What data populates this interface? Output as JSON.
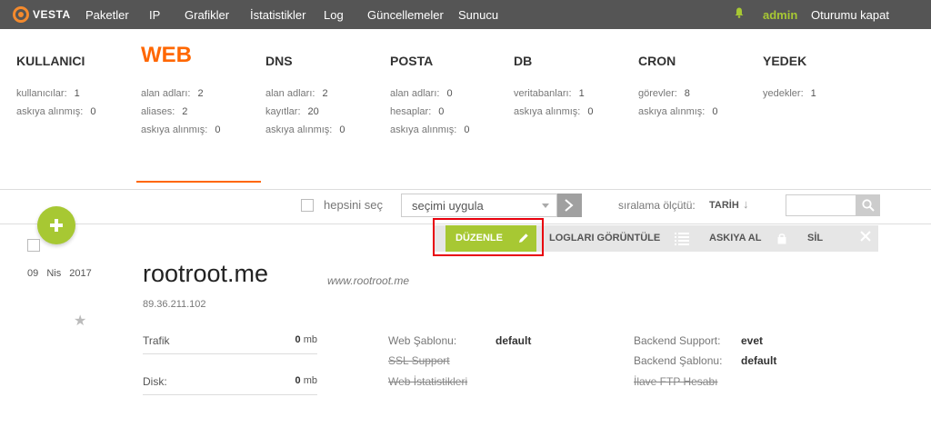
{
  "brand": {
    "name": "VESTA",
    "accent": "#ff6701",
    "green": "#a7c833",
    "highlight": "#e8000d"
  },
  "nav": {
    "items": [
      "Paketler",
      "IP",
      "Grafikler",
      "İstatistikler",
      "Log",
      "Güncellemeler",
      "Sunucu"
    ],
    "user": "admin",
    "logout": "Oturumu kapat",
    "bell_icon": "bell-icon"
  },
  "stats": [
    {
      "title": "KULLANICI",
      "rows": [
        {
          "label": "kullanıcılar:",
          "value": "1"
        },
        {
          "label": "askıya alınmış:",
          "value": "0"
        }
      ]
    },
    {
      "title": "WEB",
      "active": true,
      "rows": [
        {
          "label": "alan adları:",
          "value": "2"
        },
        {
          "label": "aliases:",
          "value": "2"
        },
        {
          "label": "askıya alınmış:",
          "value": "0"
        }
      ]
    },
    {
      "title": "DNS",
      "rows": [
        {
          "label": "alan adları:",
          "value": "2"
        },
        {
          "label": "kayıtlar:",
          "value": "20"
        },
        {
          "label": "askıya alınmış:",
          "value": "0"
        }
      ]
    },
    {
      "title": "POSTA",
      "rows": [
        {
          "label": "alan adları:",
          "value": "0"
        },
        {
          "label": "hesaplar:",
          "value": "0"
        },
        {
          "label": "askıya alınmış:",
          "value": "0"
        }
      ]
    },
    {
      "title": "DB",
      "rows": [
        {
          "label": "veritabanları:",
          "value": "1"
        },
        {
          "label": "askıya alınmış:",
          "value": "0"
        }
      ]
    },
    {
      "title": "CRON",
      "rows": [
        {
          "label": "görevler:",
          "value": "8"
        },
        {
          "label": "askıya alınmış:",
          "value": "0"
        }
      ]
    },
    {
      "title": "YEDEK",
      "rows": [
        {
          "label": "yedekler:",
          "value": "1"
        }
      ]
    }
  ],
  "toolbar": {
    "select_all": "hepsini seç",
    "bulk_select": "seçimi uygula",
    "sort_label": "sıralama ölçütü:",
    "sort_value": "TARİH",
    "sort_arrow": "↓"
  },
  "actions": {
    "edit": "DÜZENLE",
    "logs": "LOGLARI GÖRÜNTÜLE",
    "suspend": "ASKIYA AL",
    "delete": "SİL"
  },
  "record": {
    "date_day": "09",
    "date_month": "Nis",
    "date_year": "2017",
    "domain": "rootroot.me",
    "alias": "www.rootroot.me",
    "ip": "89.36.211.102",
    "traffic_label": "Trafik",
    "traffic_value": "0",
    "disk_label": "Disk:",
    "disk_value": "0",
    "unit": "mb",
    "web_template_label": "Web Şablonu:",
    "web_template_value": "default",
    "ssl_label": "SSL Support",
    "web_stats_label": "Web İstatistikleri",
    "backend_support_label": "Backend Support:",
    "backend_support_value": "evet",
    "backend_template_label": "Backend Şablonu:",
    "backend_template_value": "default",
    "ftp_label": "İlave FTP Hesabı"
  }
}
